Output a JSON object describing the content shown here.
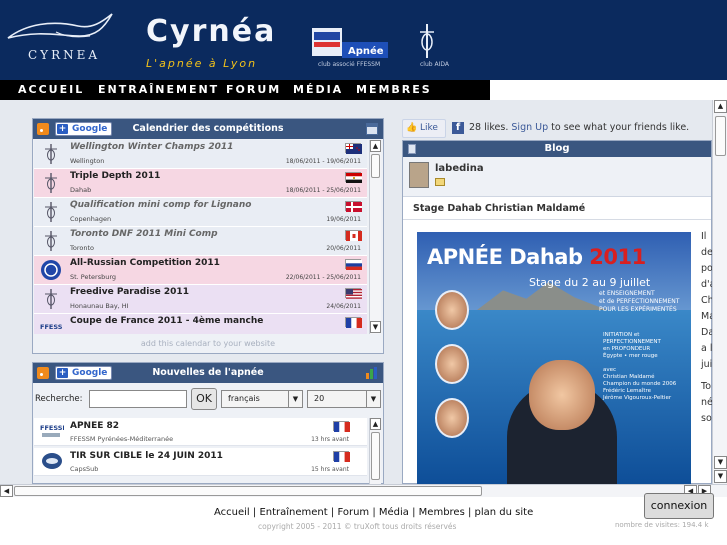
{
  "header": {
    "logo_text": "CYRNEA",
    "brand": "Cyrnéa",
    "tagline": "L'apnée à Lyon",
    "ffessm_label": "club associé FFESSM",
    "aida_label": "club AIDA"
  },
  "nav": [
    "ACCUEIL",
    "ENTRAÎNEMENT",
    "FORUM",
    "MÉDIA",
    "MEMBRES"
  ],
  "calendar": {
    "title": "Calendrier des compétitions",
    "google_label": "Google",
    "events": [
      {
        "name": "Wellington Winter Champs 2011",
        "location": "Wellington",
        "date": "18/06/2011 - 19/06/2011",
        "italic": true,
        "bg": "#e9edf4",
        "flag": "nz"
      },
      {
        "name": "Triple Depth 2011",
        "location": "Dahab",
        "date": "18/06/2011 - 25/06/2011",
        "italic": false,
        "bg": "#f6d7e3",
        "flag": "eg"
      },
      {
        "name": "Qualification mini comp for Lignano",
        "location": "Copenhagen",
        "date": "19/06/2011",
        "italic": true,
        "bg": "#e9edf4",
        "flag": "dk"
      },
      {
        "name": "Toronto DNF 2011 Mini Comp",
        "location": "Toronto",
        "date": "20/06/2011",
        "italic": true,
        "bg": "#e9edf4",
        "flag": "ca"
      },
      {
        "name": "All-Russian Competition 2011",
        "location": "St. Petersburg",
        "date": "22/06/2011 - 25/06/2011",
        "italic": false,
        "bg": "#f6d7e3",
        "flag": "ru"
      },
      {
        "name": "Freedive Paradise 2011",
        "location": "Honaunau Bay, HI",
        "date": "24/06/2011",
        "italic": false,
        "bg": "#ebe0f3",
        "flag": "us"
      },
      {
        "name": "Coupe de France 2011 - 4ème manche",
        "location": "",
        "date": "",
        "italic": false,
        "bg": "#ebe0f3",
        "flag": "fr"
      }
    ],
    "add_link": "add this calendar to your website"
  },
  "news": {
    "title": "Nouvelles de l'apnée",
    "google_label": "Google",
    "search_label": "Recherche:",
    "search_value": "",
    "ok_label": "OK",
    "lang_value": "français",
    "count_value": "20",
    "items": [
      {
        "name": "APNEE 82",
        "source": "FFESSM Pyrénées-Méditerranée",
        "ago": "13 hrs avant",
        "icon": "ffessm"
      },
      {
        "name": "TIR SUR CIBLE le 24 JUIN 2011",
        "source": "CapsSub",
        "ago": "15 hrs avant",
        "icon": "capssub"
      }
    ]
  },
  "facebook": {
    "like_label": "Like",
    "likes_text": "28 likes.",
    "signup_link": "Sign Up",
    "rest_text": "to see what your friends like."
  },
  "blog": {
    "title": "Blog",
    "username": "labedina",
    "post_title": "Stage Dahab Christian Maldamé",
    "poster": {
      "title_main": "APNÉE Dahab",
      "title_year": "2011",
      "stage": "Stage du 2 au 9 juillet",
      "sub": "et ENSEIGNEMENT\net de PERFECTIONNEMENT\nPOUR LES EXPÉRIMENTÉS",
      "info": "INITIATION et\nPERFECTIONNEMENT\nen PROFONDEUR\nÉgypte • mer rouge\n\navec\nChristian Maldamé\nChampion du monde 2006\nFrédéric Lemaître\nJérôme Vigouroux-Peltier"
    },
    "side_text": [
      "Il",
      "der",
      "pou",
      "d'a",
      "Ch",
      "Ma",
      "Da",
      "a l",
      "juill",
      "To",
      "néc",
      "sou"
    ]
  },
  "footer": {
    "links": [
      "Accueil",
      "Entraînement",
      "Forum",
      "Média",
      "Membres",
      "plan du site"
    ],
    "copyright": "copyright 2005 - 2011 © truXoft   tous droits réservés",
    "connexion": "connexion",
    "visits": "nombre de visites: 194.4 k"
  },
  "colors": {
    "header_bg": "#0b2a5e",
    "widget_head": "#3a5680",
    "tagline": "#f3c21a",
    "pink_row": "#f6d7e3",
    "purple_row": "#ebe0f3"
  }
}
